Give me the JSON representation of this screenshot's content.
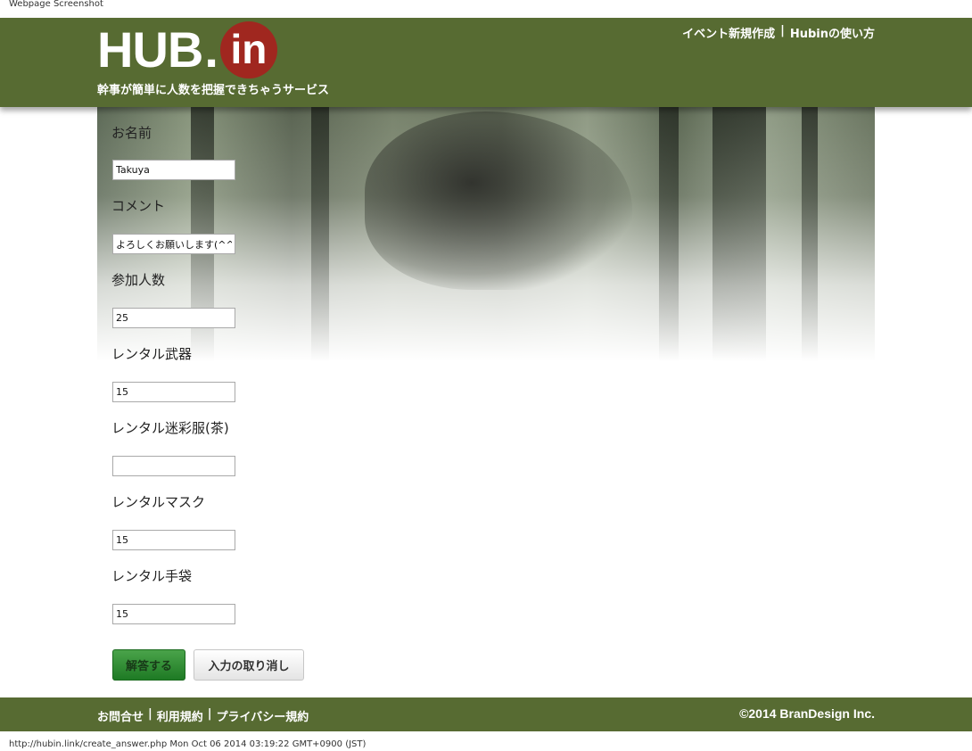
{
  "window": {
    "title": "Webpage Screenshot",
    "status_line": "http://hubin.link/create_answer.php Mon Oct 06 2014 03:19:22 GMT+0900 (JST)"
  },
  "header": {
    "logo": {
      "hub": "HUB",
      "dot": ".",
      "in": "in"
    },
    "tagline": "幹事が簡単に人数を把握できちゃうサービス",
    "nav": [
      "イベント新規作成",
      "|",
      "Hubinの使い方"
    ]
  },
  "form": {
    "fields": [
      {
        "label": "お名前",
        "value": "Takuya"
      },
      {
        "label": "コメント",
        "value": "よろしくお願いします(^^)."
      },
      {
        "label": "参加人数",
        "value": "25"
      },
      {
        "label": "レンタル武器",
        "value": "15"
      },
      {
        "label": "レンタル迷彩服(茶)",
        "value": ""
      },
      {
        "label": "レンタルマスク",
        "value": "15"
      },
      {
        "label": "レンタル手袋",
        "value": "15"
      }
    ],
    "submit_label": "解答する",
    "reset_label": "入力の取り消し"
  },
  "footer": {
    "links": [
      "お問合せ",
      "|",
      "利用規約",
      "|",
      "プライバシー規約"
    ],
    "copyright": "©2014 BranDesign Inc."
  },
  "colors": {
    "brand_green": "#576b32",
    "logo_red": "#a0271f",
    "submit_green": "#2e8b32"
  }
}
